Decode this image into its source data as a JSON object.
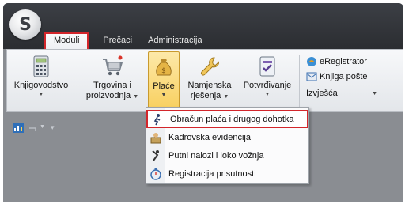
{
  "app": {
    "logo_letter": "S"
  },
  "tabs": [
    {
      "label": "Moduli",
      "active": true
    },
    {
      "label": "Prečaci",
      "active": false
    },
    {
      "label": "Administracija",
      "active": false
    }
  ],
  "ribbon": {
    "buttons": [
      {
        "line1": "Knjigovodstvo",
        "line2": "",
        "has_arrow": true,
        "icon": "calculator-icon"
      },
      {
        "line1": "Trgovina i",
        "line2": "proizvodnja",
        "has_arrow": true,
        "icon": "shopping-cart-icon"
      },
      {
        "line1": "Plaće",
        "line2": "",
        "has_arrow": true,
        "icon": "money-bag-icon",
        "pressed": true
      },
      {
        "line1": "Namjenska",
        "line2": "rješenja",
        "has_arrow": true,
        "icon": "wrench-icon"
      },
      {
        "line1": "Potvrđivanje",
        "line2": "",
        "has_arrow": true,
        "icon": "checklist-icon"
      }
    ],
    "small_items": [
      {
        "label": "eRegistrator",
        "icon": "eregistrator-icon"
      },
      {
        "label": "Knjiga pošte",
        "icon": "mail-book-icon"
      },
      {
        "label": "Izvješća",
        "icon": "",
        "has_arrow": true
      }
    ]
  },
  "dropdown": {
    "items": [
      {
        "label": "Obračun plaća i drugog dohotka",
        "icon": "payroll-runner-icon",
        "highlighted": true
      },
      {
        "label": "Kadrovska evidencija",
        "icon": "personnel-icon"
      },
      {
        "label": "Putni nalozi i loko vožnja",
        "icon": "travel-order-icon"
      },
      {
        "label": "Registracija prisutnosti",
        "icon": "stopwatch-icon"
      }
    ]
  },
  "colors": {
    "highlight_border": "#d3262b",
    "pressed_fill": "#f8cf5d",
    "window_body": "#8a8d92",
    "titlebar": "#2b2d31"
  }
}
